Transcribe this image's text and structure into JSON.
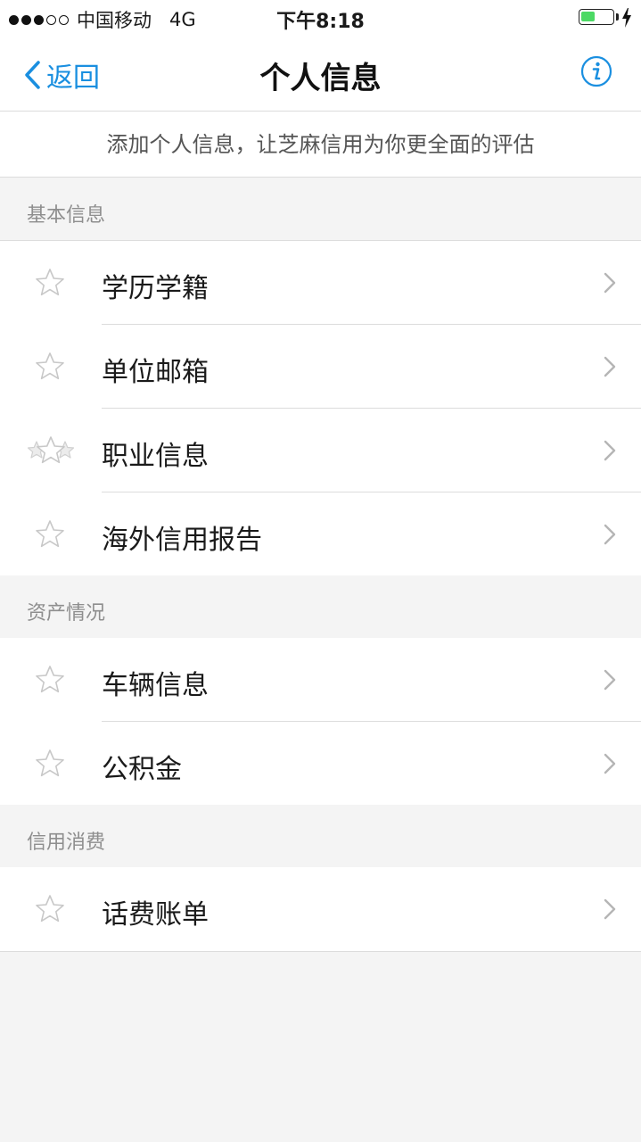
{
  "status_bar": {
    "carrier": "中国移动",
    "network": "4G",
    "time": "下午8:18",
    "signal_bars_filled": 3,
    "signal_bars_total": 5,
    "battery_level": 0.45,
    "battery_color": "#4cd964",
    "charging": true
  },
  "nav": {
    "back_label": "返回",
    "title": "个人信息",
    "info_icon": "info-circle-icon",
    "accent": "#1a8fe0"
  },
  "hint": "添加个人信息，让芝麻信用为你更全面的评估",
  "sections": [
    {
      "title": "基本信息",
      "items": [
        {
          "label": "学历学籍",
          "icon": "star-outline-icon"
        },
        {
          "label": "单位邮箱",
          "icon": "star-outline-icon"
        },
        {
          "label": "职业信息",
          "icon": "stars-multi-icon"
        },
        {
          "label": "海外信用报告",
          "icon": "star-outline-icon"
        }
      ]
    },
    {
      "title": "资产情况",
      "items": [
        {
          "label": "车辆信息",
          "icon": "star-outline-icon"
        },
        {
          "label": "公积金",
          "icon": "star-outline-icon"
        }
      ]
    },
    {
      "title": "信用消费",
      "items": [
        {
          "label": "话费账单",
          "icon": "star-outline-icon"
        }
      ]
    }
  ]
}
